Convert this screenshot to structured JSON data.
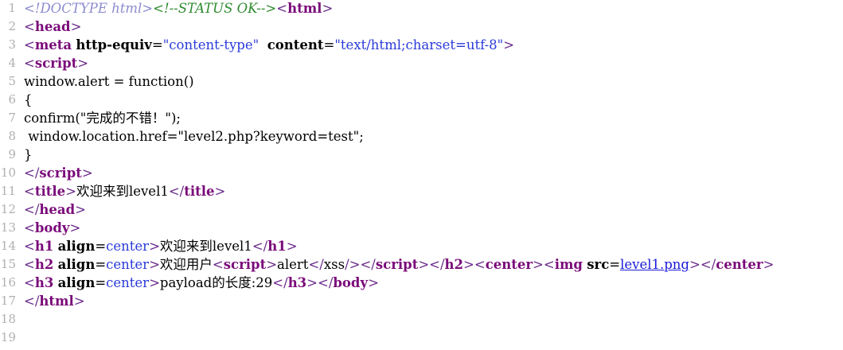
{
  "line_numbers": [
    "1",
    "2",
    "3",
    "4",
    "5",
    "6",
    "7",
    "8",
    "9",
    "10",
    "11",
    "12",
    "13",
    "14",
    "15",
    "16",
    "17",
    "18",
    "19"
  ],
  "lines": [
    [
      {
        "c": "doctype",
        "t": "<!DOCTYPE html>"
      },
      {
        "c": "comment",
        "t": "<!--STATUS OK-->"
      },
      {
        "c": "br",
        "t": "<"
      },
      {
        "c": "tag",
        "t": "html"
      },
      {
        "c": "br",
        "t": ">"
      }
    ],
    [
      {
        "c": "br",
        "t": "<"
      },
      {
        "c": "tag",
        "t": "head"
      },
      {
        "c": "br",
        "t": ">"
      }
    ],
    [
      {
        "c": "br",
        "t": "<"
      },
      {
        "c": "tag",
        "t": "meta"
      },
      {
        "c": "text",
        "t": " "
      },
      {
        "c": "attr",
        "t": "http-equiv"
      },
      {
        "c": "text",
        "t": "="
      },
      {
        "c": "val",
        "t": "\"content-type\""
      },
      {
        "c": "text",
        "t": "  "
      },
      {
        "c": "attr",
        "t": "content"
      },
      {
        "c": "text",
        "t": "="
      },
      {
        "c": "val",
        "t": "\"text/html;charset=utf-8\""
      },
      {
        "c": "br",
        "t": ">"
      }
    ],
    [
      {
        "c": "br",
        "t": "<"
      },
      {
        "c": "tag",
        "t": "script"
      },
      {
        "c": "br",
        "t": ">"
      }
    ],
    [
      {
        "c": "text",
        "t": "window.alert = function()"
      }
    ],
    [
      {
        "c": "text",
        "t": "{"
      }
    ],
    [
      {
        "c": "text",
        "t": "confirm(\"完成的不错！\");"
      }
    ],
    [
      {
        "c": "text",
        "t": " window.location.href=\"level2.php?keyword=test\";"
      }
    ],
    [
      {
        "c": "text",
        "t": "}"
      }
    ],
    [
      {
        "c": "br",
        "t": "</"
      },
      {
        "c": "tag",
        "t": "script"
      },
      {
        "c": "br",
        "t": ">"
      }
    ],
    [
      {
        "c": "br",
        "t": "<"
      },
      {
        "c": "tag",
        "t": "title"
      },
      {
        "c": "br",
        "t": ">"
      },
      {
        "c": "text",
        "t": "欢迎来到level1"
      },
      {
        "c": "br",
        "t": "</"
      },
      {
        "c": "tag",
        "t": "title"
      },
      {
        "c": "br",
        "t": ">"
      }
    ],
    [
      {
        "c": "br",
        "t": "</"
      },
      {
        "c": "tag",
        "t": "head"
      },
      {
        "c": "br",
        "t": ">"
      }
    ],
    [
      {
        "c": "br",
        "t": "<"
      },
      {
        "c": "tag",
        "t": "body"
      },
      {
        "c": "br",
        "t": ">"
      }
    ],
    [
      {
        "c": "br",
        "t": "<"
      },
      {
        "c": "tag",
        "t": "h1"
      },
      {
        "c": "text",
        "t": " "
      },
      {
        "c": "attr",
        "t": "align"
      },
      {
        "c": "text",
        "t": "="
      },
      {
        "c": "val",
        "t": "center"
      },
      {
        "c": "br",
        "t": ">"
      },
      {
        "c": "text",
        "t": "欢迎来到level1"
      },
      {
        "c": "br",
        "t": "</"
      },
      {
        "c": "tag",
        "t": "h1"
      },
      {
        "c": "br",
        "t": ">"
      }
    ],
    [
      {
        "c": "br",
        "t": "<"
      },
      {
        "c": "tag",
        "t": "h2"
      },
      {
        "c": "text",
        "t": " "
      },
      {
        "c": "attr",
        "t": "align"
      },
      {
        "c": "text",
        "t": "="
      },
      {
        "c": "val",
        "t": "center"
      },
      {
        "c": "br",
        "t": ">"
      },
      {
        "c": "text",
        "t": "欢迎用户"
      },
      {
        "c": "br",
        "t": "<"
      },
      {
        "c": "tag",
        "t": "script"
      },
      {
        "c": "br",
        "t": ">"
      },
      {
        "c": "text",
        "t": "alert"
      },
      {
        "c": "br",
        "t": "</"
      },
      {
        "c": "text",
        "t": "xss"
      },
      {
        "c": "br",
        "t": "/>"
      },
      {
        "c": "br",
        "t": "</"
      },
      {
        "c": "tag",
        "t": "script"
      },
      {
        "c": "br",
        "t": ">"
      },
      {
        "c": "br",
        "t": "</"
      },
      {
        "c": "tag",
        "t": "h2"
      },
      {
        "c": "br",
        "t": ">"
      },
      {
        "c": "br",
        "t": "<"
      },
      {
        "c": "tag",
        "t": "center"
      },
      {
        "c": "br",
        "t": ">"
      },
      {
        "c": "br",
        "t": "<"
      },
      {
        "c": "tag",
        "t": "img"
      },
      {
        "c": "text",
        "t": " "
      },
      {
        "c": "attr",
        "t": "src"
      },
      {
        "c": "text",
        "t": "="
      },
      {
        "c": "link",
        "t": "level1.png"
      },
      {
        "c": "br",
        "t": ">"
      },
      {
        "c": "br",
        "t": "</"
      },
      {
        "c": "tag",
        "t": "center"
      },
      {
        "c": "br",
        "t": ">"
      }
    ],
    [
      {
        "c": "br",
        "t": "<"
      },
      {
        "c": "tag",
        "t": "h3"
      },
      {
        "c": "text",
        "t": " "
      },
      {
        "c": "attr",
        "t": "align"
      },
      {
        "c": "text",
        "t": "="
      },
      {
        "c": "val",
        "t": "center"
      },
      {
        "c": "br",
        "t": ">"
      },
      {
        "c": "text",
        "t": "payload的长度:29"
      },
      {
        "c": "br",
        "t": "</"
      },
      {
        "c": "tag",
        "t": "h3"
      },
      {
        "c": "br",
        "t": ">"
      },
      {
        "c": "br",
        "t": "</"
      },
      {
        "c": "tag",
        "t": "body"
      },
      {
        "c": "br",
        "t": ">"
      }
    ],
    [
      {
        "c": "br",
        "t": "</"
      },
      {
        "c": "tag",
        "t": "html"
      },
      {
        "c": "br",
        "t": ">"
      }
    ],
    [],
    []
  ]
}
